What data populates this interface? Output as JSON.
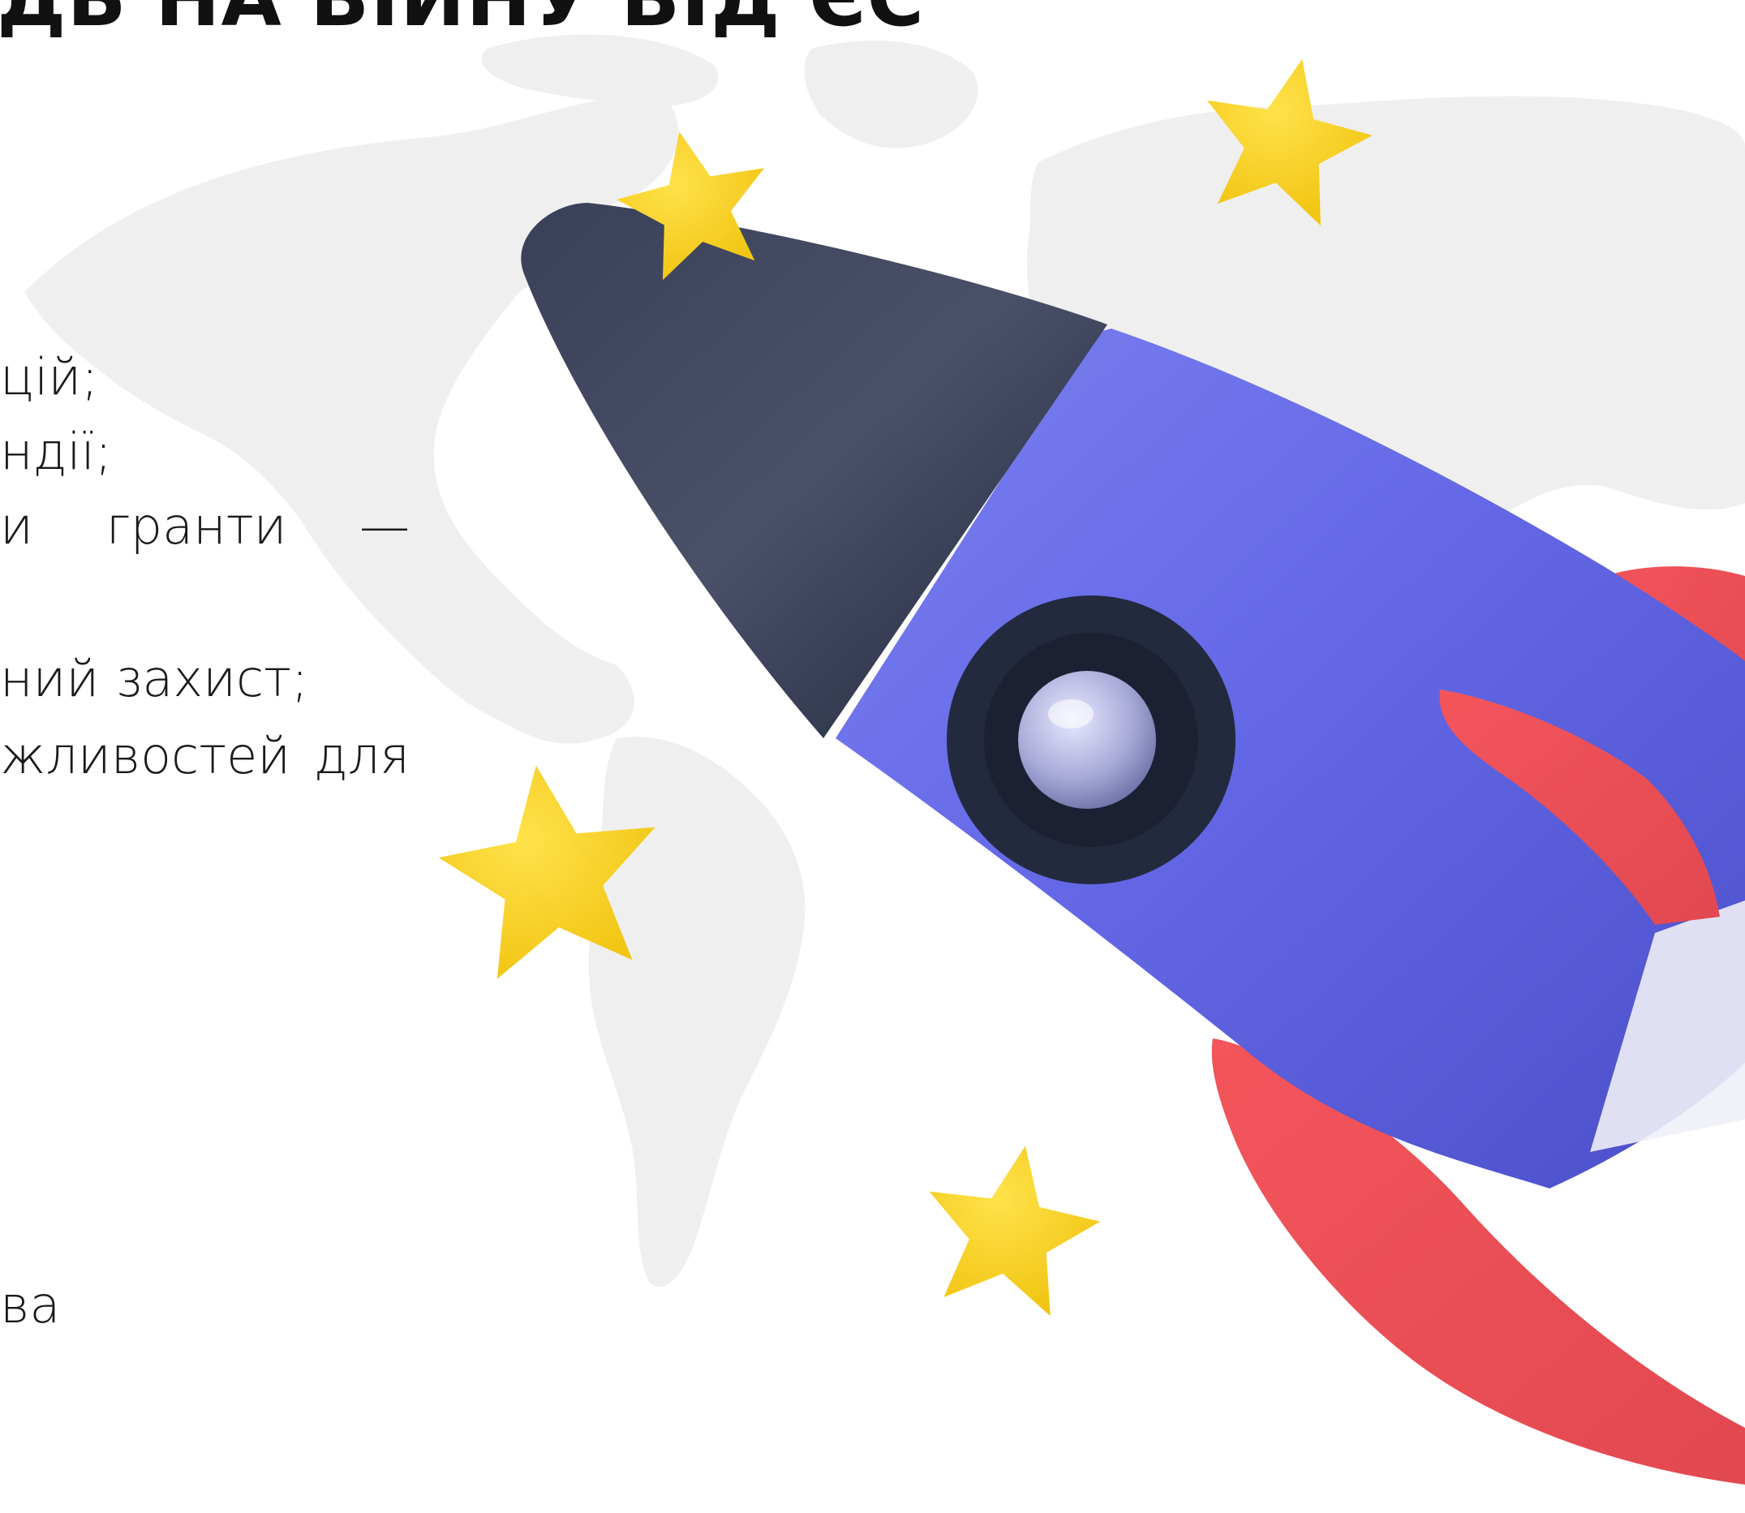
{
  "heading": {
    "text": "ДЬ НА ВІЙНУ ВІД ЄС"
  },
  "body_lines": [
    "цій;",
    "ндії;",
    [
      "и",
      "гранти",
      "—"
    ],
    "ний захист;",
    [
      "жливостей",
      "для"
    ],
    "ва"
  ],
  "illustration": {
    "background": "world-map",
    "objects": [
      "rocket",
      "star",
      "star",
      "star",
      "star"
    ]
  },
  "colors": {
    "map": "#efeff0",
    "rocket_body": "#6b6ee6",
    "rocket_nose": "#2b3145",
    "rocket_fins": "#ef5458",
    "star": "#f7d21d",
    "text": "#1a1a1a"
  }
}
